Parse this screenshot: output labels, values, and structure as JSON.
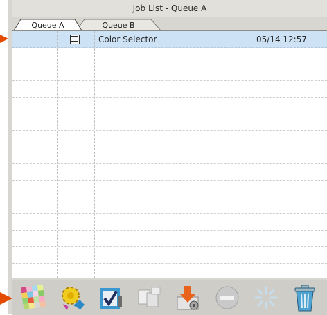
{
  "window": {
    "title": "Job List - Queue A"
  },
  "tabs": [
    {
      "label": "Queue A",
      "active": true
    },
    {
      "label": "Queue B",
      "active": false
    }
  ],
  "jobs": [
    {
      "icon": "job-form-icon",
      "name": "Color Selector",
      "datetime": "05/14 12:57",
      "selected": true
    }
  ],
  "toolbar": {
    "buttons": [
      {
        "icon": "color-palette-icon",
        "enabled": true
      },
      {
        "icon": "settings-gear-icon",
        "enabled": true
      },
      {
        "icon": "check-document-icon",
        "enabled": true
      },
      {
        "icon": "copy-pages-icon",
        "enabled": false
      },
      {
        "icon": "download-to-disk-icon",
        "enabled": true
      },
      {
        "icon": "stop-minus-icon",
        "enabled": false
      },
      {
        "icon": "busy-spinner-icon",
        "enabled": false
      },
      {
        "icon": "trash-can-icon",
        "enabled": true
      }
    ]
  },
  "colors": {
    "selection": "#cde2f5",
    "arrow": "#e34b00"
  }
}
